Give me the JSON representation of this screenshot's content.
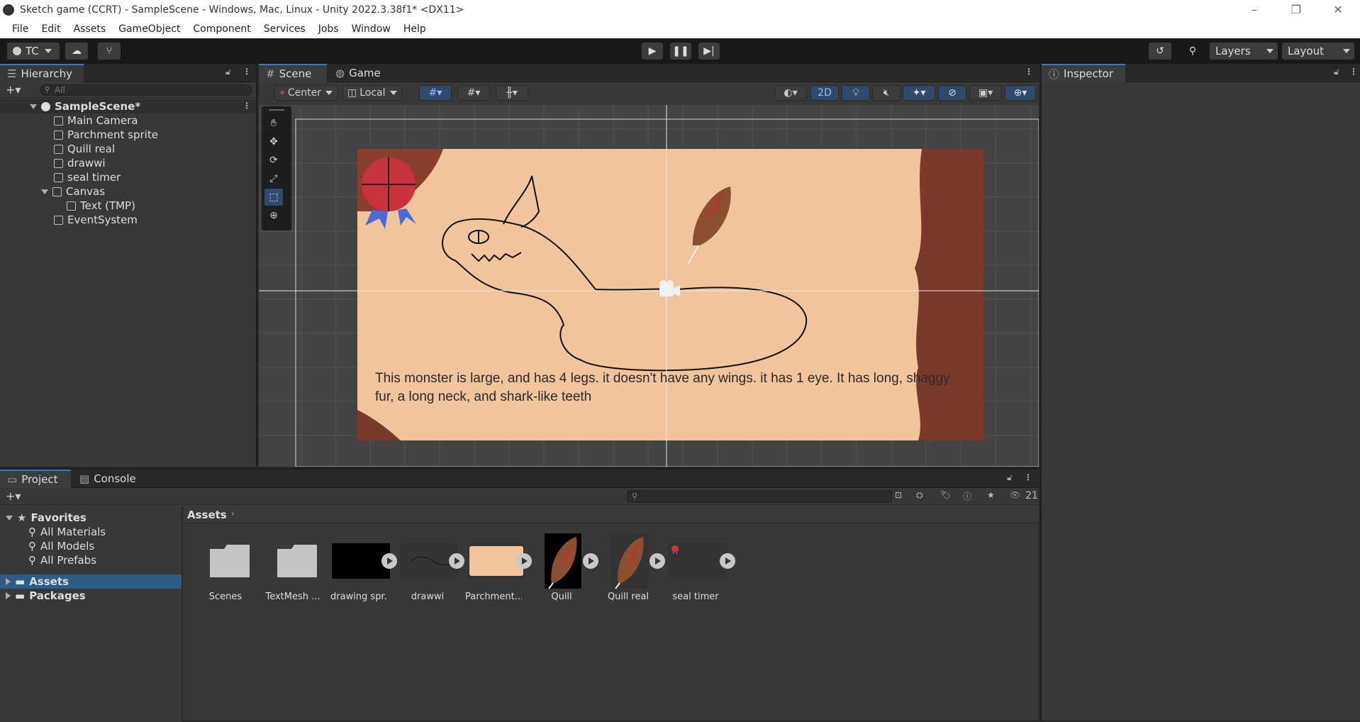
{
  "window": {
    "title": "Sketch game (CCRT) - SampleScene - Windows, Mac, Linux - Unity 2022.3.38f1* <DX11>",
    "minimize": "–",
    "restore": "❐",
    "close": "✕"
  },
  "menu": [
    "File",
    "Edit",
    "Assets",
    "GameObject",
    "Component",
    "Services",
    "Jobs",
    "Window",
    "Help"
  ],
  "toolbar": {
    "account": "TC",
    "layers": "Layers",
    "layout": "Layout"
  },
  "hierarchy": {
    "tab": "Hierarchy",
    "search_placeholder": "All",
    "scene": "SampleScene*",
    "items": [
      {
        "label": "Main Camera"
      },
      {
        "label": "Parchment sprite"
      },
      {
        "label": "Quill real"
      },
      {
        "label": "drawwi"
      },
      {
        "label": "seal timer"
      },
      {
        "label": "Canvas"
      },
      {
        "label": "Text (TMP)"
      },
      {
        "label": "EventSystem"
      }
    ]
  },
  "scene": {
    "tabs": [
      "Scene",
      "Game"
    ],
    "pivot": "Center",
    "space": "Local",
    "mode2d": "2D",
    "caption": "This monster is large, and has 4 legs. it doesn't have any wings. it has 1 eye. It has long, shaggy fur, a long neck, and shark-like teeth"
  },
  "inspector": {
    "tab": "Inspector"
  },
  "project": {
    "tabs": [
      "Project",
      "Console"
    ],
    "favorites": "Favorites",
    "fav_items": [
      "All Materials",
      "All Models",
      "All Prefabs"
    ],
    "roots": [
      "Assets",
      "Packages"
    ],
    "breadcrumb": "Assets",
    "count": "21",
    "assets": [
      "Scenes",
      "TextMesh ...",
      "drawing spr...",
      "drawwi",
      "Parchment...",
      "Quill",
      "Quill real",
      "seal timer"
    ]
  }
}
